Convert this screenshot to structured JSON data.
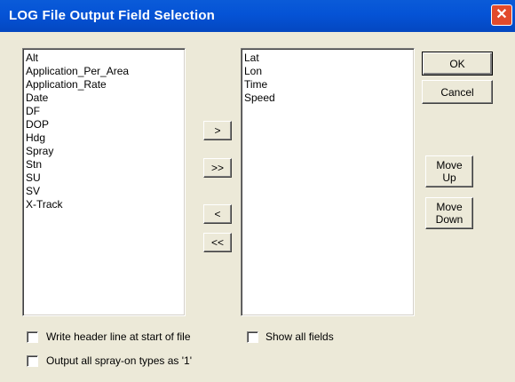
{
  "window": {
    "title": "LOG File Output Field Selection",
    "close_glyph": "✕"
  },
  "available_fields": [
    "Alt",
    "Application_Per_Area",
    "Application_Rate",
    "Date",
    "DF",
    "DOP",
    "Hdg",
    "Spray",
    "Stn",
    "SU",
    "SV",
    "X-Track"
  ],
  "selected_fields": [
    "Lat",
    "Lon",
    "Time",
    "Speed"
  ],
  "transfer_buttons": {
    "add": ">",
    "add_all": ">>",
    "remove": "<",
    "remove_all": "<<"
  },
  "buttons": {
    "ok": "OK",
    "cancel": "Cancel",
    "move_up_1": "Move",
    "move_up_2": "Up",
    "move_down_1": "Move",
    "move_down_2": "Down"
  },
  "checkboxes": {
    "write_header": {
      "label": "Write header line at start of file",
      "checked": false
    },
    "show_all": {
      "label": "Show all fields",
      "checked": false
    },
    "spray_on": {
      "label": "Output all spray-on types as '1'",
      "checked": false
    }
  }
}
